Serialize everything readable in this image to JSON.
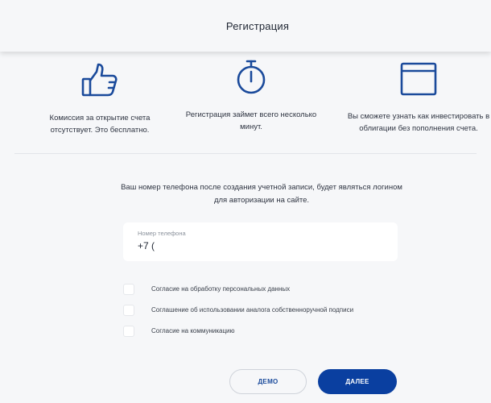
{
  "header": {
    "title": "Регистрация"
  },
  "features": [
    {
      "icon": "thumbs-up-icon",
      "text": "Комиссия за открытие счета отсутствует. Это бесплатно."
    },
    {
      "icon": "stopwatch-icon",
      "text": "Регистрация займет всего несколько минут."
    },
    {
      "icon": "browser-window-icon",
      "text": "Вы сможете узнать как инвестировать в облигации без пополнения счета."
    }
  ],
  "info": {
    "text": "Ваш номер телефона после создания учетной записи, будет являться логином для авторизации на сайте."
  },
  "phone": {
    "label": "Номер телефона",
    "value": "+7 ("
  },
  "checkboxes": [
    {
      "label": "Согласие на обработку персональных данных",
      "checked": false
    },
    {
      "label": "Соглашение об использовании аналога собственноручной подписи",
      "checked": false
    },
    {
      "label": "Согласие на коммуникацию",
      "checked": false
    }
  ],
  "buttons": {
    "demo": "ДЕМО",
    "next": "ДАЛЕЕ"
  },
  "colors": {
    "accent": "#0a3fa0",
    "icon": "#1a4a9b"
  }
}
